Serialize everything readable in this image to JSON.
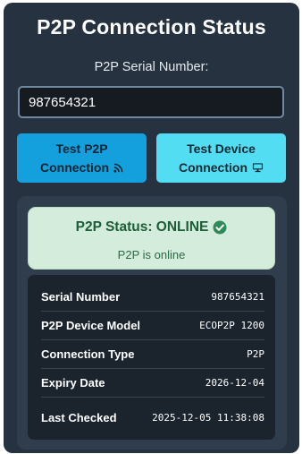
{
  "title": "P2P Connection Status",
  "serial": {
    "label": "P2P Serial Number:",
    "value": "987654321"
  },
  "buttons": {
    "test_p2p": {
      "line1": "Test P2P",
      "line2": "Connection",
      "icon": "rss-icon"
    },
    "test_device": {
      "line1": "Test Device",
      "line2": "Connection",
      "icon": "desktop-icon"
    }
  },
  "status": {
    "title": "P2P Status: ONLINE",
    "subtitle": "P2P is online",
    "icon": "check-circle-icon",
    "color": "#2e8b57"
  },
  "details": [
    {
      "label": "Serial Number",
      "value": "987654321"
    },
    {
      "label": "P2P Device Model",
      "value": "ECOP2P 1200"
    },
    {
      "label": "Connection Type",
      "value": "P2P"
    },
    {
      "label": "Expiry Date",
      "value": "2026-12-04"
    },
    {
      "label": "Last Checked",
      "value": "2025-12-05 11:38:08"
    }
  ],
  "colors": {
    "background": "#263240",
    "primary_button": "#14a0dc",
    "secondary_button": "#52ddf2",
    "status_bg": "#d3ecdb"
  }
}
